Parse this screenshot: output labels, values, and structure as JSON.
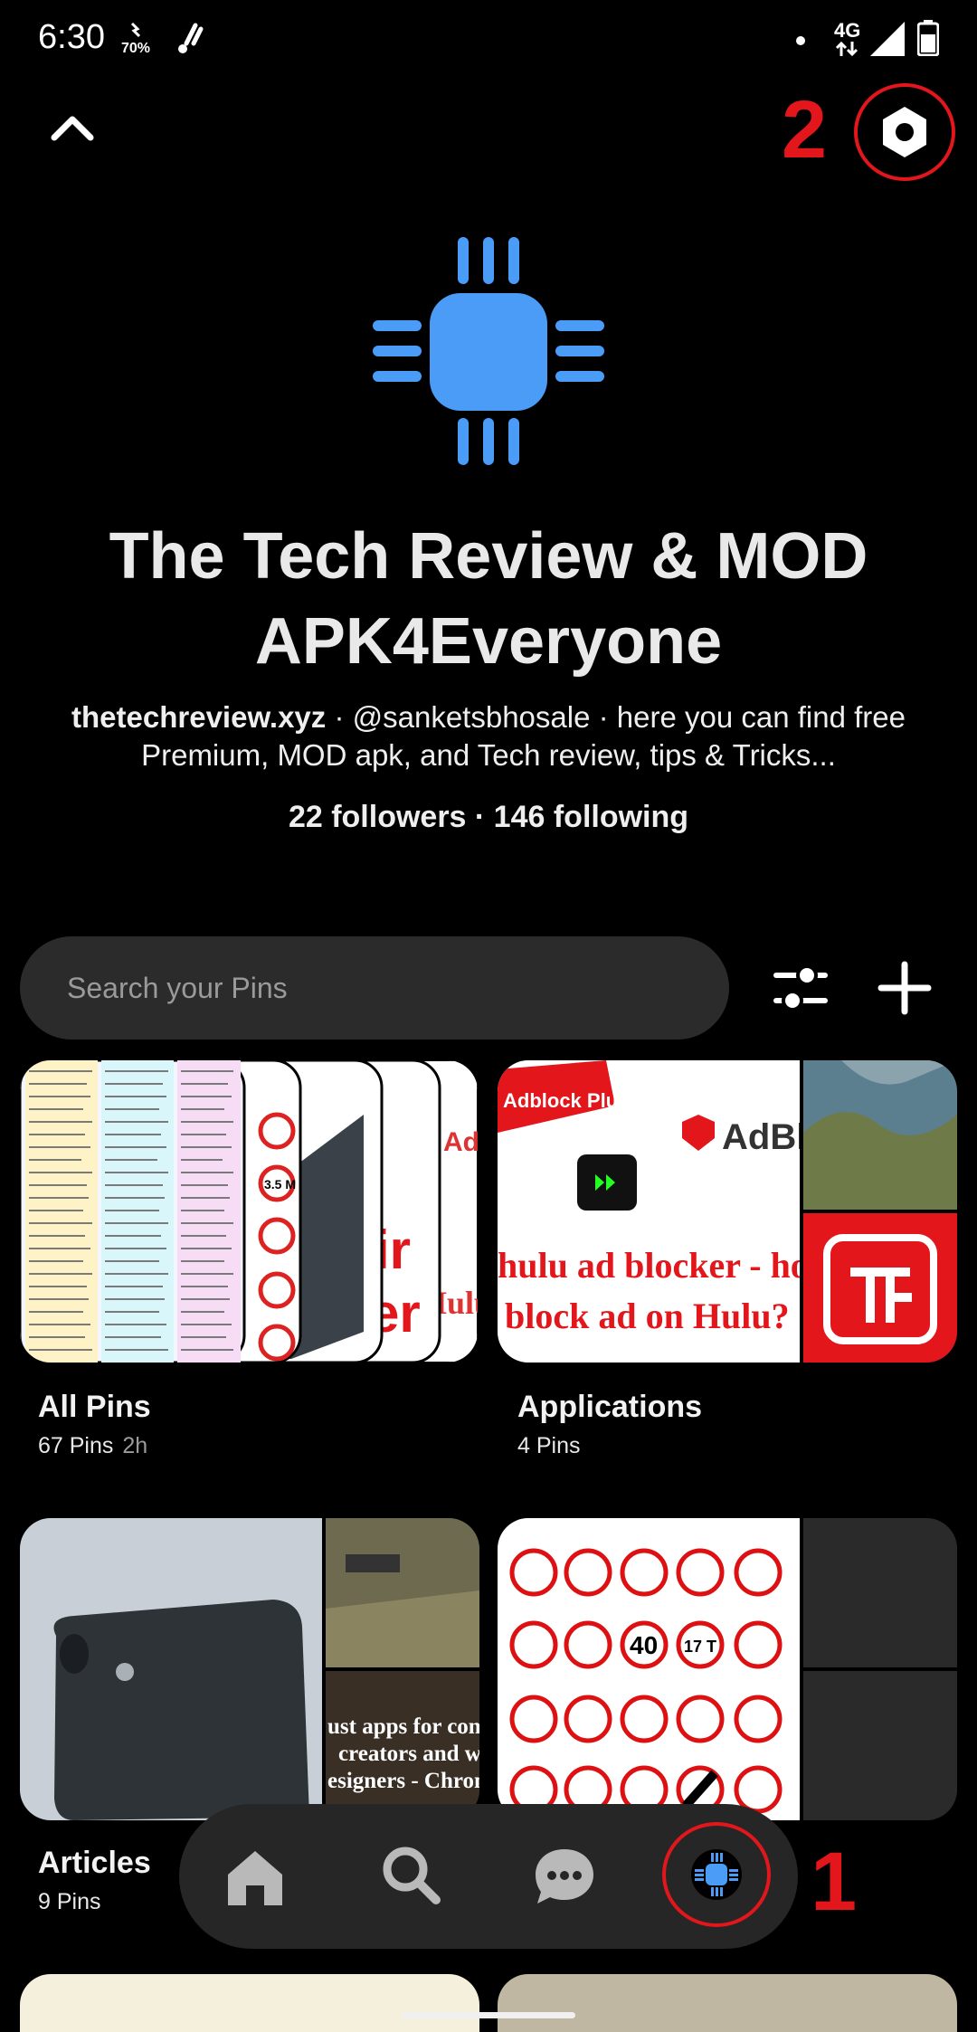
{
  "status_bar": {
    "time": "6:30",
    "battery_saver_pct": "70%",
    "network": "4G"
  },
  "profile": {
    "name": "The Tech Review & MOD APK4Everyone",
    "website": "thetechreview.xyz",
    "bio": " · @sanketsbhosale · here you can find free Premium, MOD apk, and Tech review, tips & Tricks...",
    "counts": "22 followers · 146 following"
  },
  "search": {
    "placeholder": "Search your Pins"
  },
  "boards": [
    {
      "name": "All Pins",
      "count": "67 Pins",
      "time": "2h"
    },
    {
      "name": "Applications",
      "count": "4 Pins"
    },
    {
      "name": "Articles",
      "count": "9 Pins"
    }
  ],
  "thumb_text": {
    "adblock_plus": "Adblock Plus",
    "adblock_short": "AdBl",
    "hulu_caption": "hulu ad blocker - how block ad on Hulu?",
    "hulu_left": "- hulu Hulu",
    "tricks": "ir er",
    "apps_caption": "ust apps for conten creators and webs esigners - Chrome C",
    "speed_40": "40",
    "weight_17": "17 T",
    "height_35": "3.5 M"
  },
  "annotations": {
    "one": "1",
    "two": "2"
  },
  "colors": {
    "brand_blue": "#4a9cf7",
    "annotation_red": "#e3161b",
    "background": "#000000"
  },
  "icons": {
    "back": "chevron-up-icon",
    "settings": "settings-hexagon-icon",
    "filter": "sliders-icon",
    "add": "plus-icon",
    "nav": [
      "home-icon",
      "search-icon",
      "chat-icon",
      "profile-avatar-icon"
    ]
  }
}
